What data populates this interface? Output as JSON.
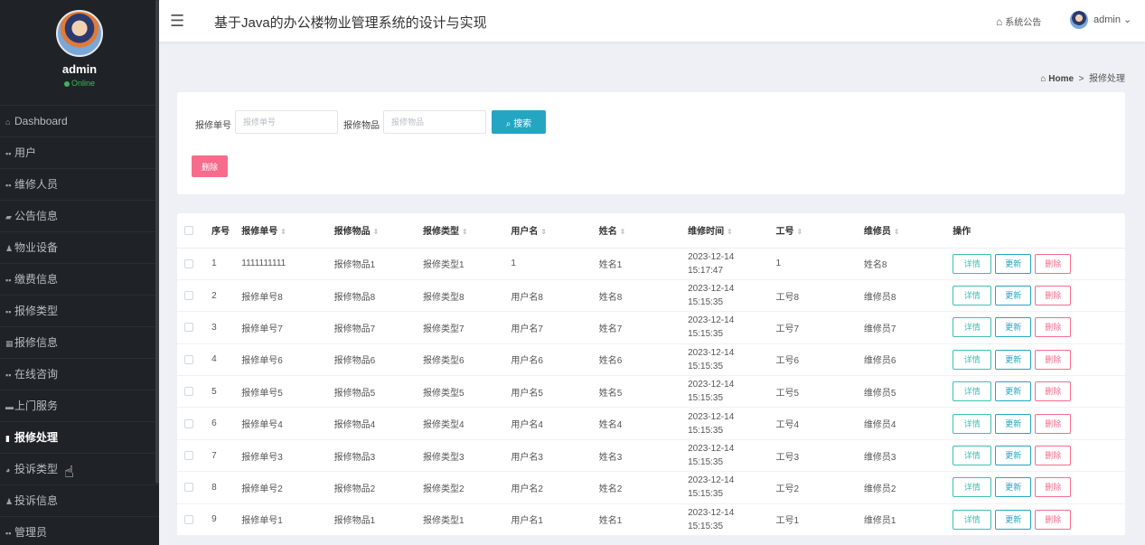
{
  "app": {
    "title": "基于Java的办公楼物业管理系统的设计与实现",
    "notice_label": "系统公告",
    "user_menu_label": "admin"
  },
  "sidebar": {
    "username": "admin",
    "status": "Online",
    "items": [
      {
        "label": "Dashboard",
        "icon": "home-icon",
        "glyph": "⌂"
      },
      {
        "label": "用户",
        "icon": "grid-icon",
        "glyph": "▪▪"
      },
      {
        "label": "维修人员",
        "icon": "grid-icon",
        "glyph": "▪▪"
      },
      {
        "label": "公告信息",
        "icon": "tag-icon",
        "glyph": "▰"
      },
      {
        "label": "物业设备",
        "icon": "user-icon",
        "glyph": "♟"
      },
      {
        "label": "缴费信息",
        "icon": "grid-icon",
        "glyph": "▪▪"
      },
      {
        "label": "报修类型",
        "icon": "grid-icon",
        "glyph": "▪▪"
      },
      {
        "label": "报修信息",
        "icon": "table-icon",
        "glyph": "▦"
      },
      {
        "label": "在线咨询",
        "icon": "grid-icon",
        "glyph": "▪▪"
      },
      {
        "label": "上门服务",
        "icon": "inbox-icon",
        "glyph": "▬"
      },
      {
        "label": "报修处理",
        "icon": "bar-chart-icon",
        "glyph": "▮"
      },
      {
        "label": "投诉类型",
        "icon": "pie-chart-icon",
        "glyph": "◕"
      },
      {
        "label": "投诉信息",
        "icon": "user-icon",
        "glyph": "♟"
      },
      {
        "label": "管理员",
        "icon": "grid-icon",
        "glyph": "▪▪"
      }
    ],
    "active_index": 10
  },
  "breadcrumb": {
    "home": "Home",
    "separator": ">",
    "current": "报修处理"
  },
  "search": {
    "fields": [
      {
        "label": "报修单号",
        "placeholder": "报修单号",
        "value": ""
      },
      {
        "label": "报修物品",
        "placeholder": "报修物品",
        "value": ""
      }
    ],
    "search_button": "搜索",
    "delete_button": "删除"
  },
  "table": {
    "columns": [
      "序号",
      "报修单号",
      "报修物品",
      "报修类型",
      "用户名",
      "姓名",
      "维修时间",
      "工号",
      "维修员",
      "操作"
    ],
    "sortable": [
      false,
      true,
      true,
      true,
      true,
      true,
      true,
      true,
      true,
      false
    ],
    "actions": {
      "detail": "详情",
      "update": "更新",
      "delete": "删除"
    },
    "rows": [
      [
        "1",
        "1111111111",
        "报修物品1",
        "报修类型1",
        "1",
        "姓名1",
        "2023-12-14 15:17:47",
        "1",
        "姓名8"
      ],
      [
        "2",
        "报修单号8",
        "报修物品8",
        "报修类型8",
        "用户名8",
        "姓名8",
        "2023-12-14 15:15:35",
        "工号8",
        "维修员8"
      ],
      [
        "3",
        "报修单号7",
        "报修物品7",
        "报修类型7",
        "用户名7",
        "姓名7",
        "2023-12-14 15:15:35",
        "工号7",
        "维修员7"
      ],
      [
        "4",
        "报修单号6",
        "报修物品6",
        "报修类型6",
        "用户名6",
        "姓名6",
        "2023-12-14 15:15:35",
        "工号6",
        "维修员6"
      ],
      [
        "5",
        "报修单号5",
        "报修物品5",
        "报修类型5",
        "用户名5",
        "姓名5",
        "2023-12-14 15:15:35",
        "工号5",
        "维修员5"
      ],
      [
        "6",
        "报修单号4",
        "报修物品4",
        "报修类型4",
        "用户名4",
        "姓名4",
        "2023-12-14 15:15:35",
        "工号4",
        "维修员4"
      ],
      [
        "7",
        "报修单号3",
        "报修物品3",
        "报修类型3",
        "用户名3",
        "姓名3",
        "2023-12-14 15:15:35",
        "工号3",
        "维修员3"
      ],
      [
        "8",
        "报修单号2",
        "报修物品2",
        "报修类型2",
        "用户名2",
        "姓名2",
        "2023-12-14 15:15:35",
        "工号2",
        "维修员2"
      ],
      [
        "9",
        "报修单号1",
        "报修物品1",
        "报修类型1",
        "用户名1",
        "姓名1",
        "2023-12-14 15:15:35",
        "工号1",
        "维修员1"
      ]
    ]
  },
  "colors": {
    "sidebar_bg": "#1f2327",
    "primary": "#24a6c2",
    "danger": "#f56c8c",
    "success": "#3eb65d",
    "detail": "#3fbfb0"
  }
}
